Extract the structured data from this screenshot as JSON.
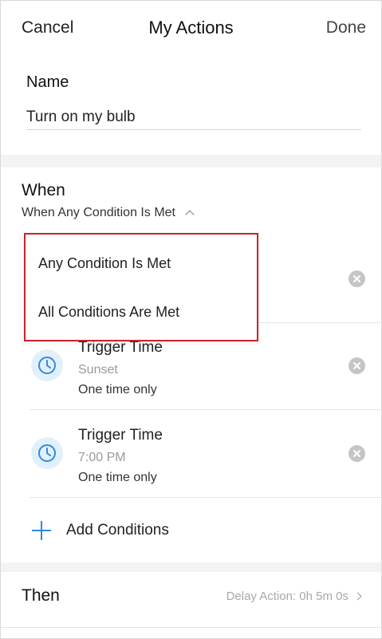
{
  "header": {
    "cancel_label": "Cancel",
    "title": "My Actions",
    "done_label": "Done"
  },
  "name_section": {
    "label": "Name",
    "value": "Turn on my bulb"
  },
  "when_section": {
    "title": "When",
    "mode_label": "When Any Condition Is Met",
    "dropdown_options": [
      "Any Condition Is Met",
      "All Conditions Are Met"
    ],
    "conditions": [
      {
        "title": "Trigger Time",
        "time": "Sunset",
        "frequency": "One time only"
      },
      {
        "title": "Trigger Time",
        "time": "7:00 PM",
        "frequency": "One time only"
      }
    ],
    "add_label": "Add Conditions"
  },
  "then_section": {
    "title": "Then",
    "delay_label": "Delay Action: 0h 5m 0s"
  },
  "colors": {
    "accent_blue": "#2e8be0",
    "clock_bg": "#e2f0fb",
    "highlight_red": "#c8242e",
    "section_gap": "#f3f3f5"
  },
  "icons": {
    "clock": "clock-icon",
    "remove": "remove-circle-icon",
    "add": "plus-icon",
    "expand": "chevron-up-icon",
    "next": "chevron-right-icon"
  }
}
